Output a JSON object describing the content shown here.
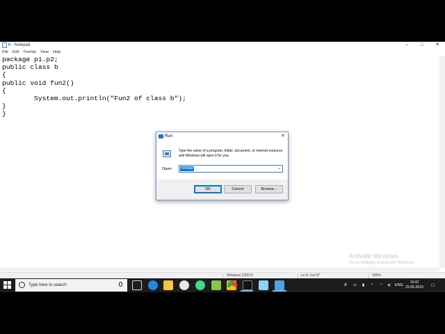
{
  "notepad": {
    "title": "b - Notepad",
    "window_controls": {
      "minimize": "–",
      "maximize": "□",
      "close": "✕"
    },
    "menu": [
      "File",
      "Edit",
      "Format",
      "View",
      "Help"
    ],
    "content_lines": [
      "package p1.p2;",
      "public class b",
      "{",
      "public void fun2()",
      "{",
      "        System.out.println(\"Fun2 of class b\");",
      "}",
      "}"
    ],
    "status": {
      "line_ending": "Windows (CRLF)",
      "position": "Ln 6, Col 37",
      "zoom": "100%"
    }
  },
  "watermark": {
    "line1": "Activate Windows",
    "line2": "Go to Settings to activate Windows."
  },
  "run_dialog": {
    "title": "Run",
    "close": "✕",
    "description": "Type the name of a program, folder, document, or Internet resource, and Windows will open it for you.",
    "open_label": "Open:",
    "open_value": "notepad",
    "ok": "OK",
    "cancel": "Cancel",
    "browse": "Browse..."
  },
  "taskbar": {
    "search_placeholder": "Type here to search",
    "language": "ENG",
    "time": "19:42",
    "date": "22-06-2019",
    "apps": [
      "task-view-icon",
      "edge-icon",
      "file-explorer-icon",
      "paint-icon",
      "android-studio-icon",
      "image-viewer-icon",
      "folder-icon",
      "chrome-icon",
      "terminal-icon",
      "paint3d-icon",
      "notepad-icon",
      "run-icon"
    ]
  }
}
